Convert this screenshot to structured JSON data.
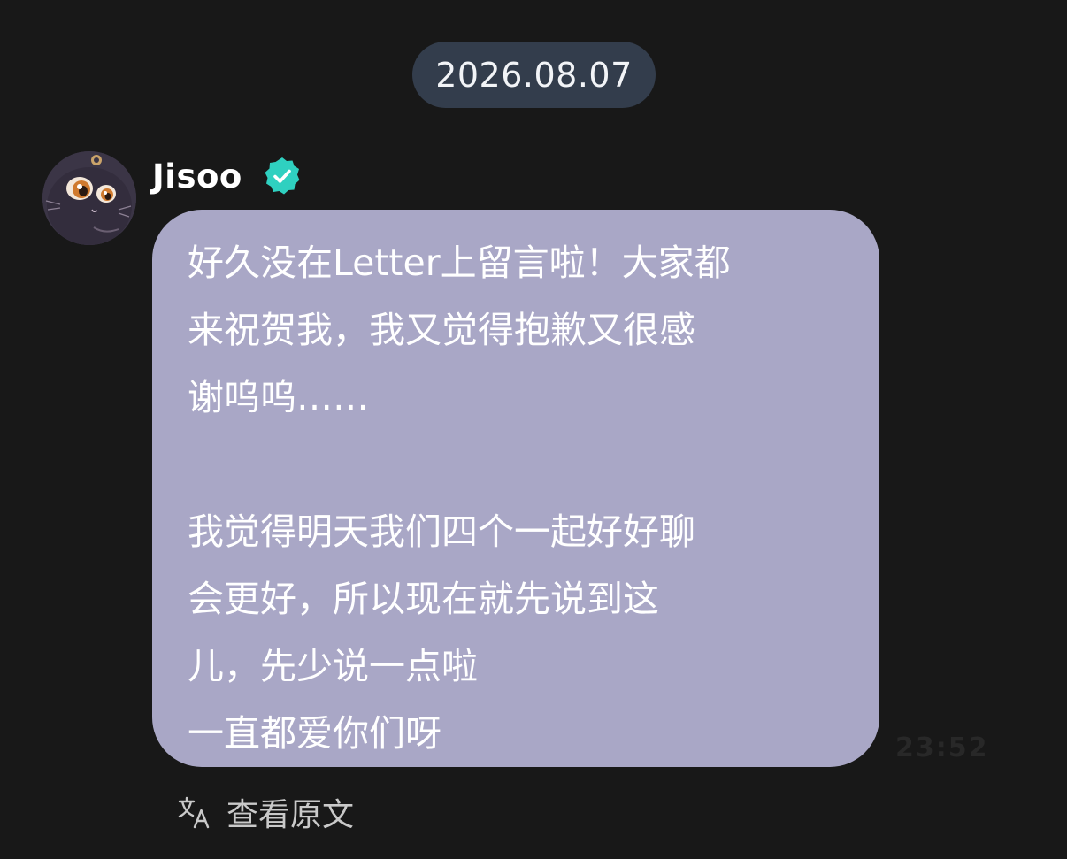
{
  "date_separator": "2026.08.07",
  "message": {
    "sender": "Jisoo",
    "verified_icon": "verified-badge-icon",
    "avatar_icon": "cat-avatar-icon",
    "lines": [
      "好久没在Letter上留言啦！大家都",
      "来祝贺我，我又觉得抱歉又很感",
      "谢呜呜……",
      "",
      "我觉得明天我们四个一起好好聊",
      "会更好，所以现在就先说到这",
      "儿，先少说一点啦",
      "一直都爱你们呀"
    ],
    "timestamp": "23:52"
  },
  "translate": {
    "icon": "translate-icon",
    "label": "查看原文"
  },
  "colors": {
    "background": "#181818",
    "date_pill": "#333d4c",
    "bubble": "#a9a7c6",
    "verified": "#2fd0c0"
  }
}
